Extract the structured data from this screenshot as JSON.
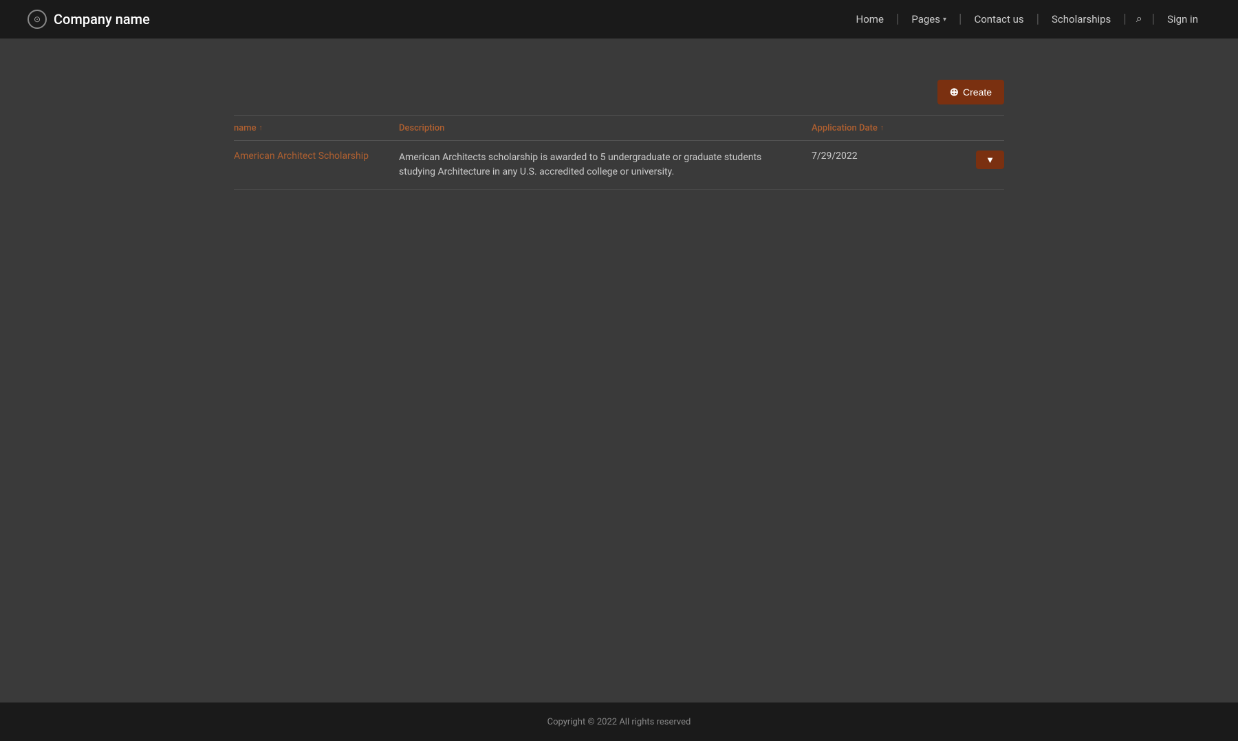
{
  "navbar": {
    "brand": {
      "name": "Company name",
      "icon_label": "circle-dot-icon"
    },
    "links": [
      {
        "label": "Home",
        "id": "home"
      },
      {
        "label": "Pages",
        "id": "pages",
        "dropdown": true
      },
      {
        "label": "Contact us",
        "id": "contact"
      },
      {
        "label": "Scholarships",
        "id": "scholarships"
      }
    ],
    "sign_in": "Sign in"
  },
  "toolbar": {
    "create_label": "Create",
    "create_icon": "+"
  },
  "table": {
    "columns": [
      {
        "label": "name",
        "sortable": true
      },
      {
        "label": "Description",
        "sortable": false
      },
      {
        "label": "Application Date",
        "sortable": true
      }
    ],
    "rows": [
      {
        "name": "American Architect Scholarship",
        "description": "American Architects scholarship is awarded to 5 undergraduate or graduate students studying Architecture in any U.S. accredited college or university.",
        "application_date": "7/29/2022"
      }
    ]
  },
  "footer": {
    "copyright": "Copyright © 2022  All rights reserved"
  },
  "actions": {
    "dropdown_icon": "▼"
  }
}
